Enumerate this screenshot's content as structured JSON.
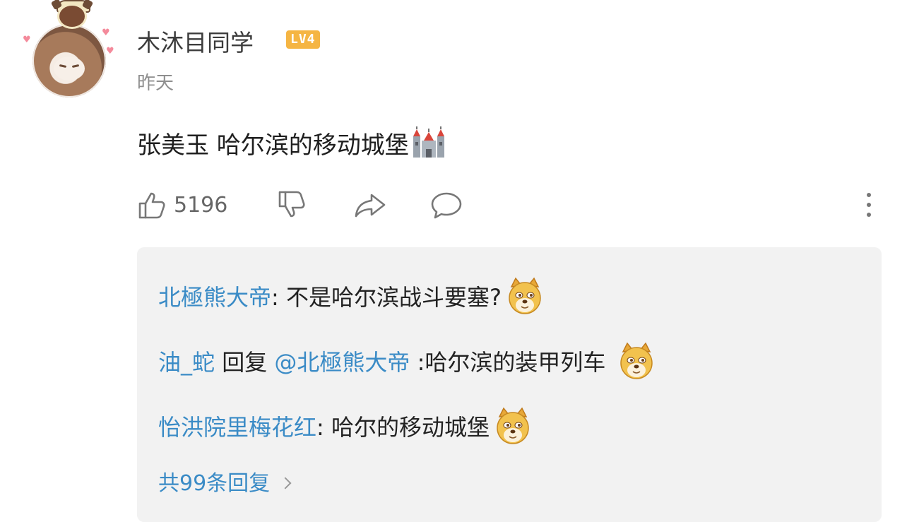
{
  "author": {
    "name": "木沐目同学",
    "level": "LV4",
    "time": "昨天"
  },
  "comment": {
    "text": "张美玉 哈尔滨的移动城堡",
    "emoji": "castle-emoji"
  },
  "actions": {
    "like_count": "5196"
  },
  "replies": [
    {
      "name": "北極熊大帝",
      "sep": ": ",
      "text": "不是哈尔滨战斗要塞?",
      "emoji": "doge-emoji"
    },
    {
      "name": "油_蛇",
      "reply_word": " 回复 ",
      "mention": "@北極熊大帝",
      "text": " :哈尔滨的装甲列车 ",
      "emoji": "doge-emoji"
    },
    {
      "name": "怡洪院里梅花红",
      "sep": ": ",
      "text": "哈尔的移动城堡",
      "emoji": "doge-emoji"
    }
  ],
  "more_replies": "共99条回复",
  "colors": {
    "link_blue": "#3a8bc6",
    "level_badge": "#f5b543",
    "reply_bg": "#f2f2f2"
  }
}
